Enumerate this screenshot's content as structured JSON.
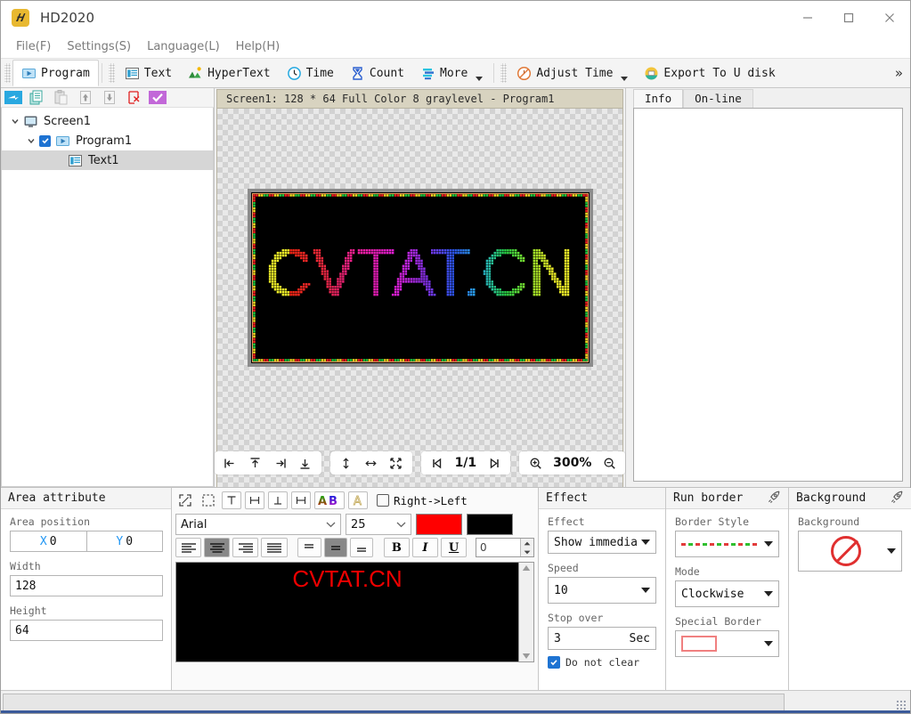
{
  "window": {
    "title": "HD2020",
    "app_icon": "hd-logo-icon",
    "minimize": "minimize-icon",
    "maximize": "maximize-icon",
    "close": "close-icon"
  },
  "menubar": {
    "items": [
      {
        "label": "File(F)"
      },
      {
        "label": "Settings(S)"
      },
      {
        "label": "Language(L)"
      },
      {
        "label": "Help(H)"
      }
    ]
  },
  "toolbar": {
    "program": {
      "label": "Program",
      "icon": "program-play-icon"
    },
    "items": [
      {
        "label": "Text",
        "icon": "text-lines-icon",
        "dropdown": false
      },
      {
        "label": "HyperText",
        "icon": "hypertext-mountain-icon",
        "dropdown": false
      },
      {
        "label": "Time",
        "icon": "clock-icon",
        "dropdown": false
      },
      {
        "label": "Count",
        "icon": "hourglass-icon",
        "dropdown": false
      },
      {
        "label": "More",
        "icon": "more-bars-icon",
        "dropdown": true
      },
      {
        "label": "Adjust Time",
        "icon": "adjust-time-icon",
        "dropdown": true
      },
      {
        "label": "Export To U disk",
        "icon": "usb-export-icon",
        "dropdown": false
      }
    ],
    "overflow": "»"
  },
  "tree": {
    "tools": [
      {
        "name": "send-icon"
      },
      {
        "name": "copy-pages-icon"
      },
      {
        "name": "paste-icon"
      },
      {
        "name": "move-up-icon"
      },
      {
        "name": "move-down-icon"
      },
      {
        "name": "delete-icon"
      },
      {
        "name": "check-all-icon"
      }
    ],
    "nodes": [
      {
        "label": "Screen1",
        "icon": "monitor-icon",
        "level": 0,
        "expanded": true,
        "checkbox": false,
        "selected": false
      },
      {
        "label": "Program1",
        "icon": "program-play-icon",
        "level": 1,
        "expanded": true,
        "checkbox": true,
        "selected": false
      },
      {
        "label": "Text1",
        "icon": "text-lines-icon",
        "level": 2,
        "expanded": false,
        "checkbox": false,
        "selected": true
      }
    ]
  },
  "preview": {
    "header": "Screen1: 128 * 64 Full Color 8 graylevel - Program1",
    "led_text": "CVTAT.CN",
    "nav": {
      "align_left": "align-left-edge-icon",
      "align_top": "align-top-edge-icon",
      "align_right": "align-right-edge-icon",
      "align_bottom": "align-bottom-edge-icon",
      "fit_height": "fit-height-icon",
      "fit_width": "fit-width-icon",
      "fit_screen": "fit-screen-icon",
      "prev": "prev-page-icon",
      "page": "1/1",
      "next": "next-page-icon",
      "zoom_in": "zoom-in-icon",
      "zoom_level": "300%",
      "zoom_out": "zoom-out-icon"
    }
  },
  "rightpanel": {
    "tabs": [
      {
        "label": "Info",
        "active": true
      },
      {
        "label": "On-line",
        "active": false
      }
    ]
  },
  "area_attribute": {
    "title": "Area attribute",
    "position_label": "Area position",
    "x_key": "X",
    "x_value": "0",
    "y_key": "Y",
    "y_value": "0",
    "width_label": "Width",
    "width_value": "128",
    "height_label": "Height",
    "height_value": "64"
  },
  "text_panel": {
    "tools": [
      {
        "name": "expand-area-icon"
      },
      {
        "name": "select-area-icon"
      },
      {
        "name": "text-tool-icon"
      },
      {
        "name": "fit-horizontal-icon"
      },
      {
        "name": "fit-vertical-icon"
      },
      {
        "name": "fit-both-icon"
      },
      {
        "name": "colorful-text-icon"
      },
      {
        "name": "outline-text-icon"
      }
    ],
    "rtl_checkbox": {
      "label": "Right->Left",
      "checked": false
    },
    "font_family": "Arial",
    "font_size": "25",
    "fore_color": "#ff0000",
    "back_color": "#000000",
    "align_buttons": [
      {
        "name": "align-left-icon",
        "active": false
      },
      {
        "name": "align-center-icon",
        "active": true
      },
      {
        "name": "align-right-icon",
        "active": false
      },
      {
        "name": "align-justify-icon",
        "active": false
      }
    ],
    "valign_buttons": [
      {
        "name": "valign-top-icon",
        "active": false
      },
      {
        "name": "valign-middle-icon",
        "active": true
      },
      {
        "name": "valign-bottom-icon",
        "active": false
      }
    ],
    "style_buttons": [
      {
        "name": "bold-icon",
        "label": "B",
        "active": false
      },
      {
        "name": "italic-icon",
        "label": "I",
        "active": false
      },
      {
        "name": "underline-icon",
        "label": "U",
        "active": false
      }
    ],
    "spacing_value": "0",
    "preview_text": "CVTAT.CN"
  },
  "effect": {
    "title": "Effect",
    "effect_label": "Effect",
    "effect_value": "Show immedia",
    "speed_label": "Speed",
    "speed_value": "10",
    "stopover_label": "Stop over",
    "stopover_value": "3",
    "stopover_unit": "Sec",
    "do_not_clear": {
      "label": "Do not clear",
      "checked": true
    }
  },
  "run_border": {
    "title": "Run border",
    "title_icon": "rocket-icon",
    "style_label": "Border Style",
    "style_value": "dashed-rgb-border",
    "mode_label": "Mode",
    "mode_value": "Clockwise",
    "special_label": "Special Border",
    "special_value": "red-rect-border"
  },
  "background": {
    "title": "Background",
    "title_icon": "rocket-icon",
    "label": "Background",
    "value": "none-forbidden-icon"
  },
  "colors": {
    "accent": "#1e73d2",
    "led_red": "#ff0000",
    "header_bg": "#d8d3c0",
    "toolbar_bg": "#f4f4f4"
  },
  "chart_data": null
}
